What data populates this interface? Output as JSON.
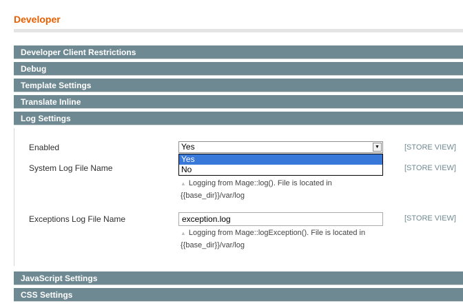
{
  "page": {
    "title": "Developer"
  },
  "sections": {
    "developer_client_restrictions": "Developer Client Restrictions",
    "debug": "Debug",
    "template_settings": "Template Settings",
    "translate_inline": "Translate Inline",
    "log_settings": "Log Settings",
    "javascript_settings": "JavaScript Settings",
    "css_settings": "CSS Settings"
  },
  "log_settings": {
    "enabled": {
      "label": "Enabled",
      "value": "Yes",
      "options": [
        "Yes",
        "No"
      ],
      "scope": "[STORE VIEW]"
    },
    "system_log": {
      "label": "System Log File Name",
      "scope": "[STORE VIEW]",
      "note_line1": "Logging from Mage::log(). File is located in",
      "note_line2": "{{base_dir}}/var/log"
    },
    "exceptions_log": {
      "label": "Exceptions Log File Name",
      "value": "exception.log",
      "scope": "[STORE VIEW]",
      "note_line1": "Logging from Mage::logException(). File is located in",
      "note_line2": "{{base_dir}}/var/log"
    }
  },
  "colors": {
    "accent": "#eb5e00",
    "section_bar": "#6f8992",
    "option_highlight": "#3878d8"
  }
}
